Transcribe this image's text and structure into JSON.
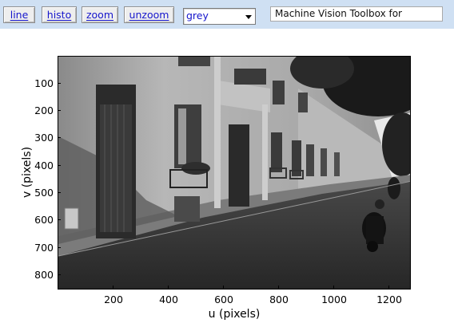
{
  "toolbar": {
    "buttons": {
      "line": "line",
      "histo": "histo",
      "zoom": "zoom",
      "unzoom": "unzoom"
    },
    "colormap_select": {
      "selected": "grey"
    },
    "title_field": "Machine Vision Toolbox for"
  },
  "plot": {
    "xlabel": "u (pixels)",
    "ylabel": "v (pixels)",
    "xticks": [
      "200",
      "400",
      "600",
      "800",
      "1000",
      "1200"
    ],
    "yticks": [
      "100",
      "200",
      "300",
      "400",
      "500",
      "600",
      "700",
      "800"
    ]
  },
  "colors": {
    "toolbar_bg": "#cfe0f3",
    "button_text": "#1515cc"
  }
}
